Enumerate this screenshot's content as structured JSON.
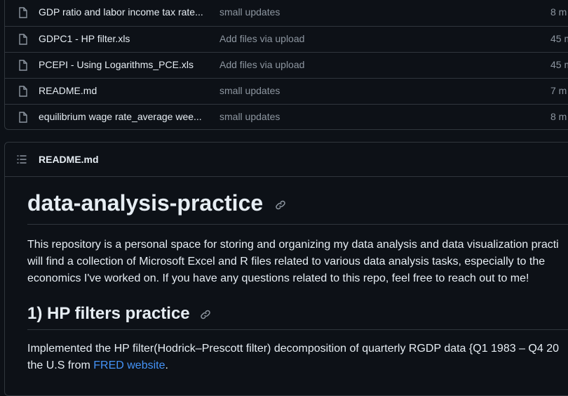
{
  "files": [
    {
      "name": "GDP ratio and labor income tax rate...",
      "message": "small updates",
      "age": "8 m"
    },
    {
      "name": "GDPC1 - HP filter.xls",
      "message": "Add files via upload",
      "age": "45 m"
    },
    {
      "name": "PCEPI - Using Logarithms_PCE.xls",
      "message": "Add files via upload",
      "age": "45 m"
    },
    {
      "name": "README.md",
      "message": "small updates",
      "age": "7 m"
    },
    {
      "name": "equilibrium wage rate_average wee...",
      "message": "small updates",
      "age": "8 m"
    }
  ],
  "readme": {
    "header_title": "README.md",
    "h1": "data-analysis-practice",
    "intro_lines": [
      "This repository is a personal space for storing and organizing my data analysis and data visualization practi",
      "will find a collection of Microsoft Excel and R files related to various data analysis tasks, especially to the",
      "economics I've worked on. If you have any questions related to this repo, feel free to reach out to me!"
    ],
    "h2": "1) HP filters practice",
    "hp_line1": "Implemented the HP filter(Hodrick–Prescott filter) decomposition of quarterly RGDP data {Q1 1983 – Q4 20",
    "hp_line2_prefix": "the U.S from ",
    "hp_link": "FRED website",
    "hp_line2_suffix": "."
  },
  "colors": {
    "background": "#0d1117",
    "border": "#30363d",
    "text": "#e6edf3",
    "muted": "#8d96a0",
    "link": "#4493f8"
  },
  "icons": {
    "file": "file-icon",
    "list": "list-icon",
    "anchor": "link-icon"
  }
}
